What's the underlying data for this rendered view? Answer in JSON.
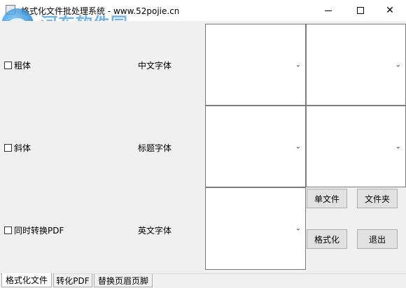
{
  "window": {
    "title": "格式化文件批处理系统 - www.52pojie.cn",
    "controls": {
      "minimize": "—",
      "maximize": "□",
      "close": "✕"
    }
  },
  "watermark": {
    "name": "河东软件园",
    "url": "www.pc0359.cn"
  },
  "options": {
    "bold_label": "粗体",
    "italic_label": "斜体",
    "convert_pdf_label": "同时转换PDF"
  },
  "fonts": {
    "chinese_label": "中文字体",
    "title_label": "标题字体",
    "english_label": "英文字体"
  },
  "buttons": {
    "single_file": "单文件",
    "folder": "文件夹",
    "format": "格式化",
    "exit": "退出"
  },
  "tabs": [
    "格式化文件",
    "转化PDF",
    "替换页眉页脚"
  ],
  "icons": {
    "dropdown": "chevron-down-icon",
    "app": "app-icon"
  }
}
